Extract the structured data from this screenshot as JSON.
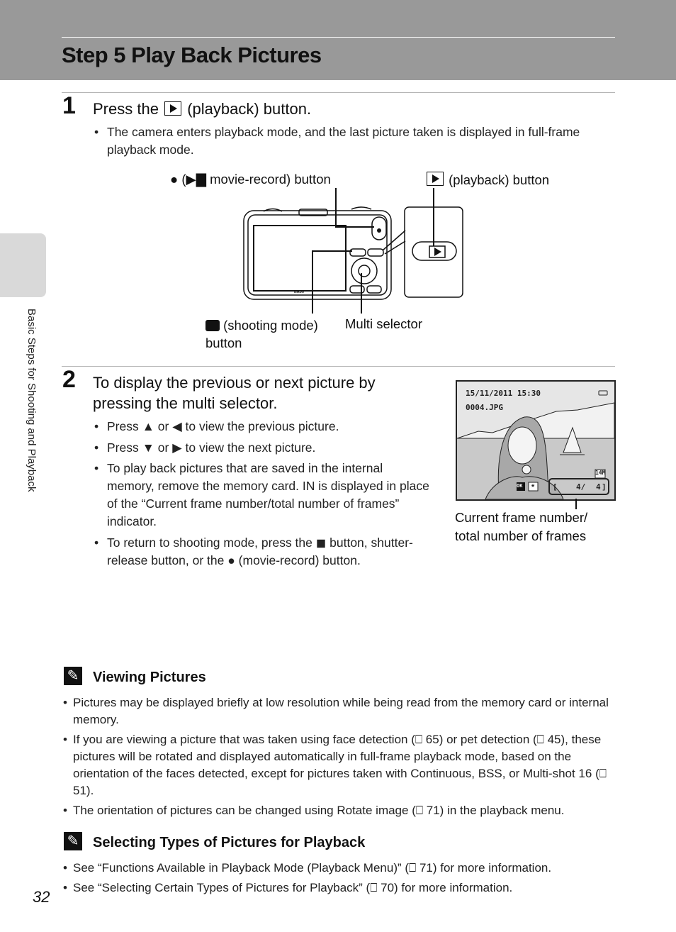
{
  "header": {
    "title": "Step 5 Play Back Pictures"
  },
  "side_tab": {
    "label": "Basic Steps for Shooting and Playback"
  },
  "step1": {
    "number": "1",
    "title_pre": "Press the",
    "title_post": "(playback) button.",
    "bullets": [
      "The camera enters playback mode, and the last picture taken is displayed in full-frame playback mode."
    ],
    "diagram": {
      "movie_label_pre": "● (",
      "movie_label_icon": "movie-camera-icon",
      "movie_label_post": " movie-record) button",
      "playback_label": "(playback) button",
      "shooting_label_line1": "(shooting mode)",
      "shooting_label_line2": "button",
      "multi_selector_label": "Multi selector",
      "brand": "Nikon"
    }
  },
  "step2": {
    "number": "2",
    "title": "To display the previous or next picture by pressing the multi selector.",
    "bullets": [
      "Press ▲ or ◀ to view the previous picture.",
      "Press ▼ or ▶ to view the next picture.",
      "To play back pictures that are saved in the internal memory, remove the memory card. IN is displayed in place of the “Current frame number/total number of frames” indicator.",
      "To return to shooting mode, press the ◼ button, shutter-release button, or the ● (movie-record) button."
    ],
    "lcd": {
      "datetime": "15/11/2011 15:30",
      "filename": "0004.JPG",
      "image_size": "14M",
      "ok_label": "OK",
      "frame_current": "4/",
      "frame_total": "4",
      "caption_line1": "Current frame number/",
      "caption_line2": "total number of frames"
    }
  },
  "note1": {
    "title": "Viewing Pictures",
    "bullets": [
      "Pictures may be displayed briefly at low resolution while being read from the memory card or internal memory.",
      "If you are viewing a picture that was taken using face detection (⎕ 65) or pet detection (⎕ 45), these pictures will be rotated and displayed automatically in full-frame playback mode, based on the orientation of the faces detected, except for pictures taken with Continuous, BSS, or Multi-shot 16 (⎕ 51).",
      "The orientation of pictures can be changed using Rotate image (⎕ 71) in the playback menu."
    ]
  },
  "note2": {
    "title": "Selecting Types of Pictures for Playback",
    "bullets": [
      "See “Functions Available in Playback Mode (Playback Menu)” (⎕ 71) for more information.",
      "See “Selecting Certain Types of Pictures for Playback” (⎕ 70) for more information."
    ]
  },
  "footer": {
    "page_number": "32"
  }
}
